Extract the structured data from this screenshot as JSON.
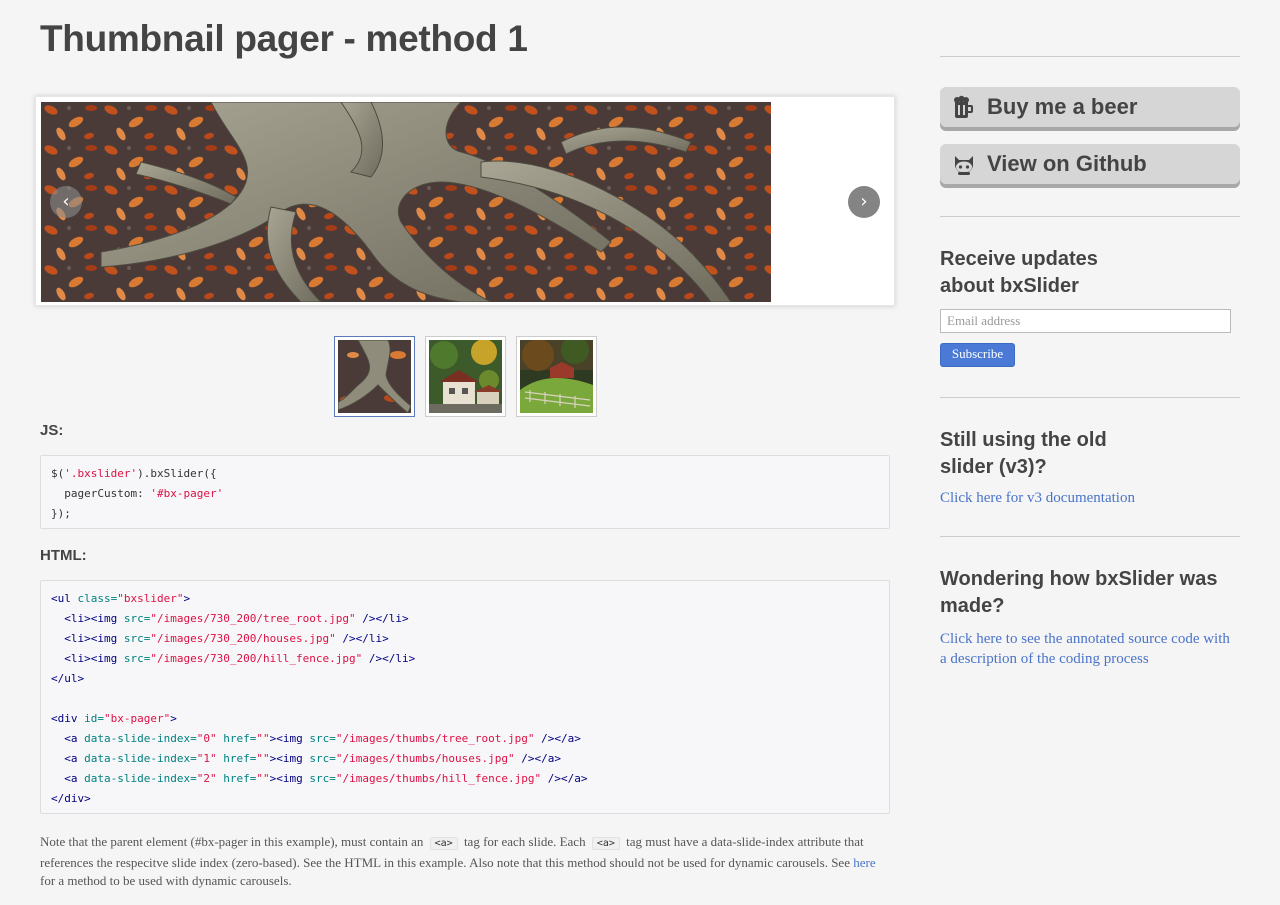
{
  "page": {
    "title": "Thumbnail pager - method 1"
  },
  "slider": {
    "prev_glyph": "‹",
    "next_glyph": "›",
    "prev_icon": "chevron-left-icon",
    "next_icon": "chevron-right-icon"
  },
  "pager": {
    "items": [
      {
        "thumb": "tree_root"
      },
      {
        "thumb": "houses"
      },
      {
        "thumb": "hill_fence"
      }
    ],
    "active_index": 0
  },
  "js_section": {
    "label": "JS:",
    "lines": [
      [
        {
          "t": "$(",
          "c": "plain"
        },
        {
          "t": "'.bxslider'",
          "c": "str"
        },
        {
          "t": ").bxSlider({",
          "c": "plain"
        }
      ],
      [
        {
          "t": "  pagerCustom: ",
          "c": "plain"
        },
        {
          "t": "'#bx-pager'",
          "c": "str"
        }
      ],
      [
        {
          "t": "});",
          "c": "plain"
        }
      ]
    ]
  },
  "html_section": {
    "label": "HTML:",
    "lines": [
      [
        {
          "t": "<ul ",
          "c": "tag"
        },
        {
          "t": "class=",
          "c": "attr"
        },
        {
          "t": "\"bxslider\"",
          "c": "str"
        },
        {
          "t": ">",
          "c": "tag"
        }
      ],
      [
        {
          "t": "  <li><img ",
          "c": "tag"
        },
        {
          "t": "src=",
          "c": "attr"
        },
        {
          "t": "\"/images/730_200/tree_root.jpg\"",
          "c": "str"
        },
        {
          "t": " /></li>",
          "c": "tag"
        }
      ],
      [
        {
          "t": "  <li><img ",
          "c": "tag"
        },
        {
          "t": "src=",
          "c": "attr"
        },
        {
          "t": "\"/images/730_200/houses.jpg\"",
          "c": "str"
        },
        {
          "t": " /></li>",
          "c": "tag"
        }
      ],
      [
        {
          "t": "  <li><img ",
          "c": "tag"
        },
        {
          "t": "src=",
          "c": "attr"
        },
        {
          "t": "\"/images/730_200/hill_fence.jpg\"",
          "c": "str"
        },
        {
          "t": " /></li>",
          "c": "tag"
        }
      ],
      [
        {
          "t": "</ul>",
          "c": "tag"
        }
      ],
      [
        {
          "t": "",
          "c": "plain"
        }
      ],
      [
        {
          "t": "<div ",
          "c": "tag"
        },
        {
          "t": "id=",
          "c": "attr"
        },
        {
          "t": "\"bx-pager\"",
          "c": "str"
        },
        {
          "t": ">",
          "c": "tag"
        }
      ],
      [
        {
          "t": "  <a ",
          "c": "tag"
        },
        {
          "t": "data-slide-index=",
          "c": "attr"
        },
        {
          "t": "\"0\"",
          "c": "str"
        },
        {
          "t": " ",
          "c": "plain"
        },
        {
          "t": "href=",
          "c": "attr"
        },
        {
          "t": "\"\"",
          "c": "str"
        },
        {
          "t": "><img ",
          "c": "tag"
        },
        {
          "t": "src=",
          "c": "attr"
        },
        {
          "t": "\"/images/thumbs/tree_root.jpg\"",
          "c": "str"
        },
        {
          "t": " /></a>",
          "c": "tag"
        }
      ],
      [
        {
          "t": "  <a ",
          "c": "tag"
        },
        {
          "t": "data-slide-index=",
          "c": "attr"
        },
        {
          "t": "\"1\"",
          "c": "str"
        },
        {
          "t": " ",
          "c": "plain"
        },
        {
          "t": "href=",
          "c": "attr"
        },
        {
          "t": "\"\"",
          "c": "str"
        },
        {
          "t": "><img ",
          "c": "tag"
        },
        {
          "t": "src=",
          "c": "attr"
        },
        {
          "t": "\"/images/thumbs/houses.jpg\"",
          "c": "str"
        },
        {
          "t": " /></a>",
          "c": "tag"
        }
      ],
      [
        {
          "t": "  <a ",
          "c": "tag"
        },
        {
          "t": "data-slide-index=",
          "c": "attr"
        },
        {
          "t": "\"2\"",
          "c": "str"
        },
        {
          "t": " ",
          "c": "plain"
        },
        {
          "t": "href=",
          "c": "attr"
        },
        {
          "t": "\"\"",
          "c": "str"
        },
        {
          "t": "><img ",
          "c": "tag"
        },
        {
          "t": "src=",
          "c": "attr"
        },
        {
          "t": "\"/images/thumbs/hill_fence.jpg\"",
          "c": "str"
        },
        {
          "t": " /></a>",
          "c": "tag"
        }
      ],
      [
        {
          "t": "</div>",
          "c": "tag"
        }
      ]
    ]
  },
  "note": {
    "part1": "Note that the parent element (#bx-pager in this example), must contain an",
    "code1": "<a>",
    "part2": "tag for each slide. Each",
    "code2": "<a>",
    "part3": "tag must have a data-slide-index attribute that references the respecitve slide index (zero-based). See the HTML in this example. Also note that this method should not be used for dynamic carousels. See",
    "link": "here",
    "part4": "for a method to be used with dynamic carousels."
  },
  "sidebar": {
    "beer_button": {
      "label": "Buy me a beer",
      "icon": "beer-mug-icon"
    },
    "github_button": {
      "label": "View on Github",
      "icon": "github-octocat-icon"
    },
    "updates": {
      "heading_line1": "Receive updates",
      "heading_line2": "about bxSlider",
      "email_placeholder": "Email address",
      "subscribe_label": "Subscribe"
    },
    "old_slider": {
      "heading_line1": "Still using the old",
      "heading_line2": "slider (v3)?",
      "link": "Click here for v3 documentation"
    },
    "wondering": {
      "heading_line1": "Wondering how bxSlider was",
      "heading_line2": "made?",
      "link": "Click here to see the annotated source code with a description of the coding process"
    }
  },
  "colors": {
    "background": "#f5f5f5",
    "link": "#4a74c9",
    "subscribe": "#4a7ad6",
    "code_string": "#dd1144",
    "code_tag": "#000080",
    "code_attr": "#008080"
  }
}
